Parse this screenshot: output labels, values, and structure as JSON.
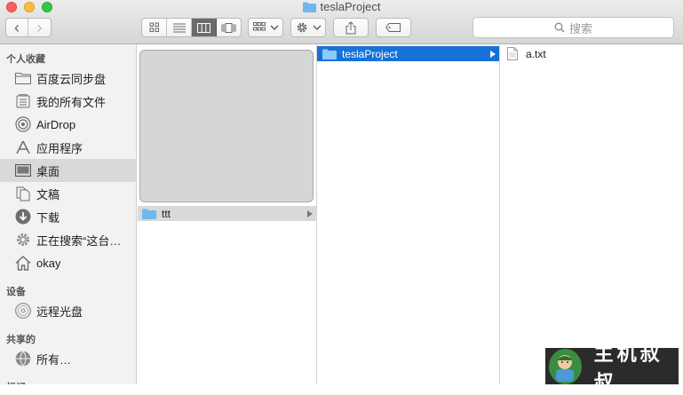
{
  "window": {
    "title": "teslaProject"
  },
  "toolbar": {
    "back_label": "‹",
    "forward_label": "›",
    "search_placeholder": "搜索"
  },
  "sidebar": {
    "sections": [
      {
        "heading": "个人收藏"
      },
      {
        "heading": "设备"
      },
      {
        "heading": "共享的"
      },
      {
        "heading": "标记"
      }
    ],
    "favorites": [
      {
        "label": "百度云同步盘",
        "icon": "folder-icon"
      },
      {
        "label": "我的所有文件",
        "icon": "all-files-icon"
      },
      {
        "label": "AirDrop",
        "icon": "airdrop-icon"
      },
      {
        "label": "应用程序",
        "icon": "applications-icon"
      },
      {
        "label": "桌面",
        "icon": "desktop-icon",
        "selected": true
      },
      {
        "label": "文稿",
        "icon": "documents-icon"
      },
      {
        "label": "下载",
        "icon": "downloads-icon"
      },
      {
        "label": "正在搜索“这台…",
        "icon": "gear-icon"
      },
      {
        "label": "okay",
        "icon": "home-icon"
      }
    ],
    "devices": [
      {
        "label": "远程光盘",
        "icon": "disc-icon"
      }
    ],
    "shared": [
      {
        "label": "所有…",
        "icon": "network-icon"
      }
    ]
  },
  "columns": {
    "col1": [
      {
        "name": "ttt",
        "type": "folder",
        "state": "inactive-selected"
      }
    ],
    "col2": [
      {
        "name": "teslaProject",
        "type": "folder",
        "state": "active-selected"
      }
    ],
    "col3": [
      {
        "name": "a.txt",
        "type": "file"
      }
    ]
  },
  "watermark": {
    "text": "主机叔叔"
  },
  "colors": {
    "accent": "#1672d8",
    "folder": "#6cb8ef"
  }
}
